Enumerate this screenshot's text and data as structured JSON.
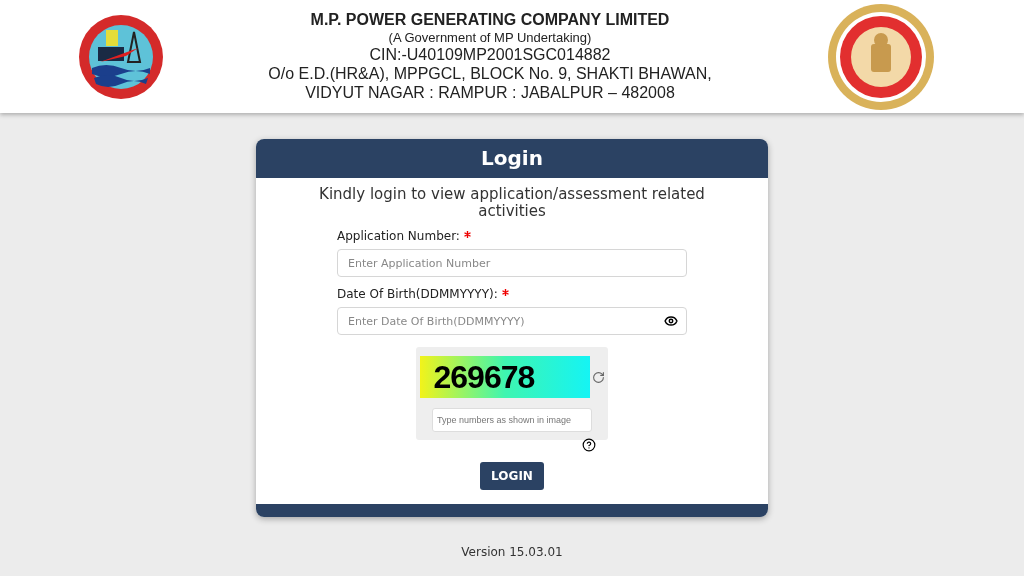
{
  "header": {
    "lines": [
      "M.P. POWER GENERATING COMPANY LIMITED",
      "(A Government of MP Undertaking)",
      "CIN:-U40109MP2001SGC014882",
      "O/o E.D.(HR&A), MPPGCL, BLOCK No. 9, SHAKTI BHAWAN,",
      "VIDYUT NAGAR : RAMPUR : JABALPUR – 482008"
    ]
  },
  "login": {
    "title": "Login",
    "intro": "Kindly login to view application/assessment related activities",
    "fields": [
      {
        "label": "Application Number:",
        "required": true,
        "placeholder": "Enter Application Number",
        "kind": "text"
      },
      {
        "label": "Date Of Birth(DDMMYYYY):",
        "required": true,
        "placeholder": "Enter Date Of Birth(DDMMYYYY)",
        "kind": "password"
      }
    ],
    "captcha": {
      "code": "269678",
      "placeholder": "Type numbers as shown in image"
    },
    "button": "LOGIN"
  },
  "footer": "Version 15.03.01"
}
